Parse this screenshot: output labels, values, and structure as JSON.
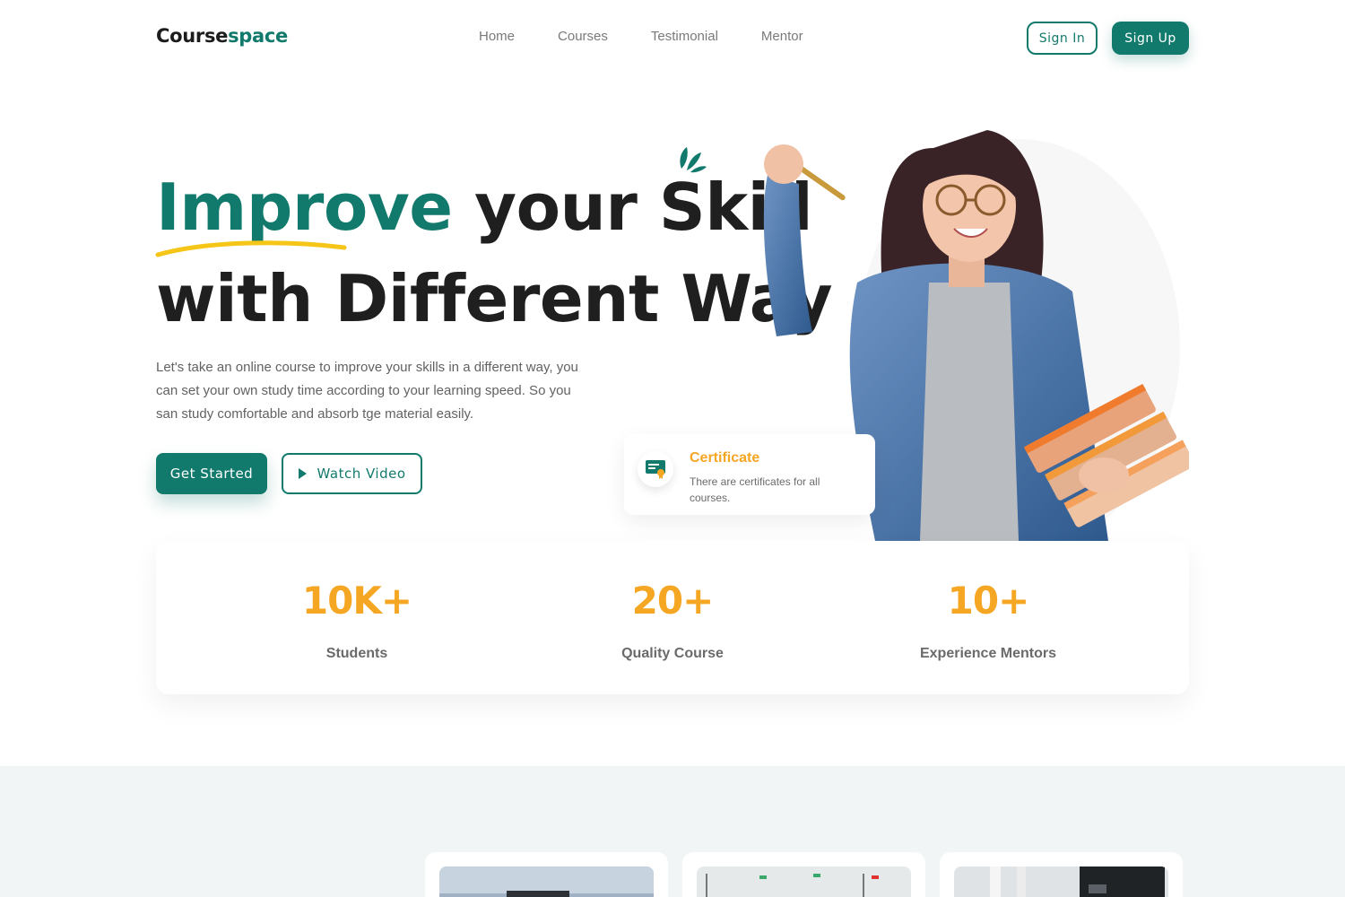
{
  "nav": {
    "logo_main": "Course",
    "logo_accent": "space",
    "links": [
      "Home",
      "Courses",
      "Testimonial",
      "Mentor"
    ],
    "sign_in": "Sign In",
    "sign_up": "Sign Up"
  },
  "hero": {
    "headline_highlight": "Improve",
    "headline_rest_line1": " your Skill",
    "headline_line2": "with Different Way",
    "paragraph": "Let's take an online course to improve your skills in a different way, you can set your own study time according to your learning speed. So you san study comfortable and absorb tge material easily.",
    "get_started": "Get Started",
    "watch_video": "Watch Video"
  },
  "certificate": {
    "title": "Certificate",
    "description": "There are certificates for all courses."
  },
  "stats": [
    {
      "value": "10K+",
      "label": "Students"
    },
    {
      "value": "20+",
      "label": "Quality Course"
    },
    {
      "value": "10+",
      "label": "Experience Mentors"
    }
  ],
  "colors": {
    "primary": "#127a6c",
    "accent": "#f5a623",
    "underline": "#f5c518",
    "section_bg": "#f1f5f5"
  },
  "icons": {
    "certificate": "certificate-icon",
    "play": "play-icon",
    "decor": "sparkle-decoration"
  }
}
